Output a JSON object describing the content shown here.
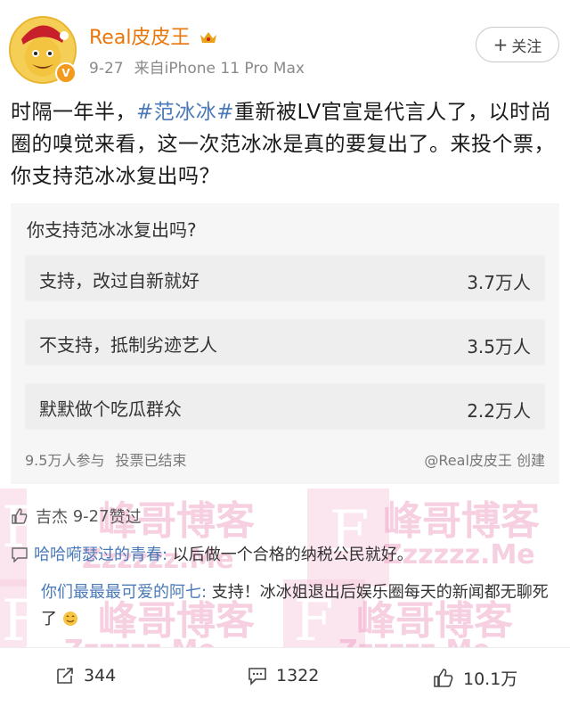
{
  "author": {
    "name": "Real皮皮王",
    "time": "9-27",
    "device": "来自iPhone 11 Pro Max",
    "follow_label": "关注",
    "verified_mark": "V"
  },
  "post": {
    "text_before": "时隔一年半，",
    "hashtag": "#范冰冰#",
    "text_after": "重新被LV官宣是代言人了，以时尚圈的嗅觉来看，这一次范冰冰是真的要复出了。来投个票，你支持范冰冰复出吗？"
  },
  "poll": {
    "question": "你支持范冰冰复出吗?",
    "options": [
      {
        "label": "支持，改过自新就好",
        "count": "3.7万人"
      },
      {
        "label": "不支持，抵制劣迹艺人",
        "count": "3.5万人"
      },
      {
        "label": "默默做个吃瓜群众",
        "count": "2.2万人"
      }
    ],
    "participants": "9.5万人参与",
    "status": "投票已结束",
    "creator": "@Real皮皮王 创建"
  },
  "likes": {
    "liker": "吉杰",
    "date": "9-27",
    "action": "赞过"
  },
  "comments": [
    {
      "name": "哈哈嗬瑟过的青春:",
      "text": " 以后做一个合格的纳税公民就好。"
    },
    {
      "name": "你们最最最可爱的阿七:",
      "text": " 支持！冰冰姐退出后娱乐圈每天的新闻都无聊死了"
    }
  ],
  "watermarks": {
    "blog_name": "峰哥博客",
    "blog_url": "Zzzzzz.Me",
    "letter": "F"
  },
  "actions": {
    "repost_count": "344",
    "comment_count": "1322",
    "like_count": "10.1万"
  },
  "colors": {
    "username": "#e8760a",
    "link": "#4a7ab8",
    "watermark": "#f0a8c8"
  }
}
